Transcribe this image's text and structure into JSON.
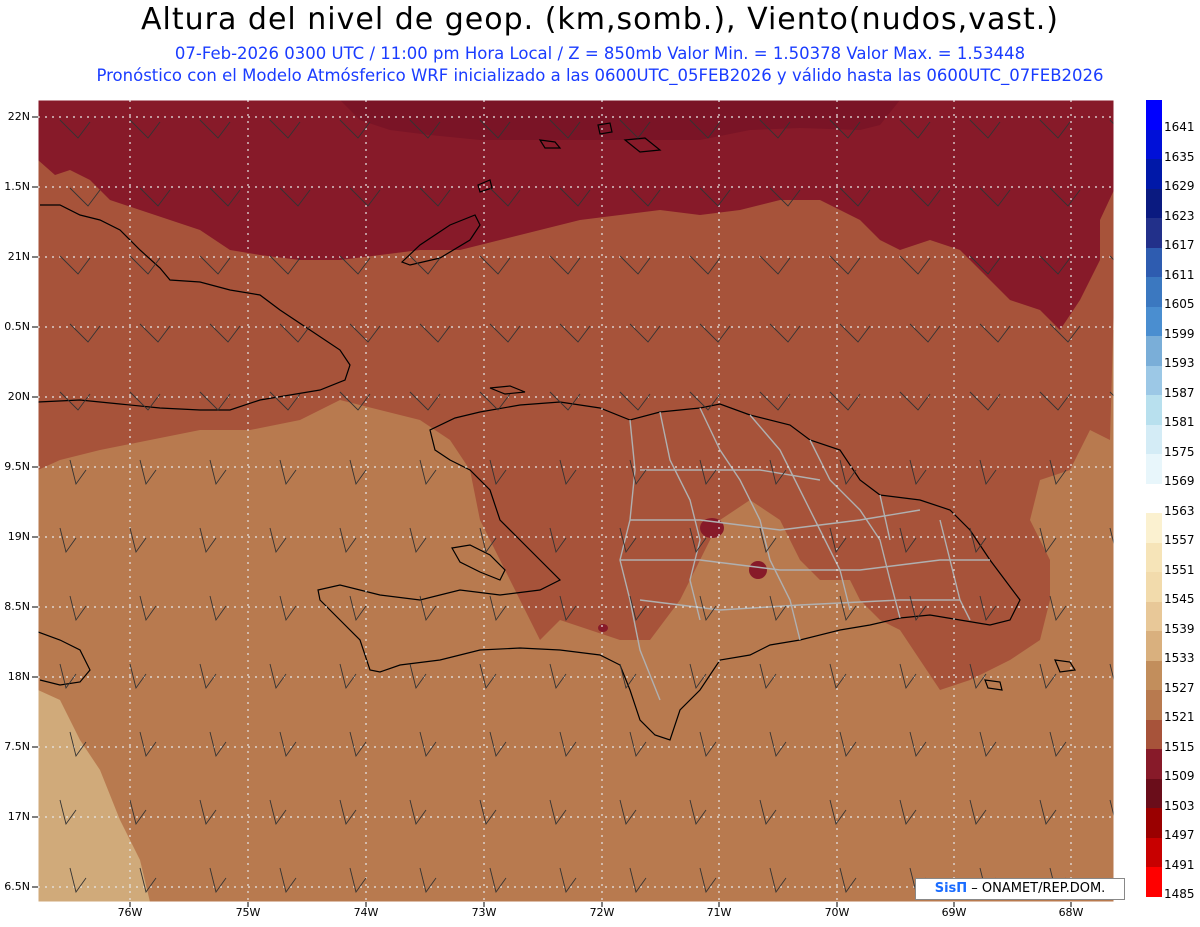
{
  "header": {
    "title": "Altura del nivel de geop. (km,somb.), Viento(nudos,vast.)",
    "line1": "07-Feb-2026  0300 UTC / 11:00 pm Hora Local / Z = 850mb    Valor Min. = 1.50378  Valor Max. = 1.53448",
    "line2": "Pronóstico con el Modelo Atmósferico WRF inicializado a las 0600UTC_05FEB2026 y válido hasta las  0600UTC_07FEB2026"
  },
  "map": {
    "lat_labels": [
      "22N",
      "1.5N",
      "21N",
      "0.5N",
      "20N",
      "9.5N",
      "19N",
      "8.5N",
      "18N",
      "7.5N",
      "17N",
      "6.5N"
    ],
    "lon_labels": [
      "76W",
      "75W",
      "74W",
      "73W",
      "72W",
      "71W",
      "70W",
      "69W",
      "68W"
    ],
    "fill_colors": {
      "highest": "#7a1426",
      "high": "#871a29",
      "mid": "#a7533a",
      "low": "#b87a4f",
      "lowest": "#d0aa7a"
    }
  },
  "colorbar": {
    "labels": [
      "1641",
      "1635",
      "1629",
      "1623",
      "1617",
      "1611",
      "1605",
      "1599",
      "1593",
      "1587",
      "1581",
      "1575",
      "1569",
      "1563",
      "1557",
      "1551",
      "1545",
      "1539",
      "1533",
      "1527",
      "1521",
      "1515",
      "1509",
      "1503",
      "1497",
      "1491",
      "1485"
    ],
    "colors": [
      "#0000ff",
      "#0010d8",
      "#0018a8",
      "#0a1a80",
      "#22308a",
      "#2e5cb0",
      "#3b78c0",
      "#4a8ed0",
      "#7aaed8",
      "#9cc8e6",
      "#b8e0ee",
      "#d4ecf6",
      "#e8f6fb",
      "#ffffff",
      "#fbf1d0",
      "#f6e4b8",
      "#f2dbac",
      "#e8c898",
      "#d9b07e",
      "#c28e5c",
      "#b87a4f",
      "#a7533a",
      "#871a29",
      "#6a0d1a",
      "#9a0000",
      "#c80000",
      "#ff0000"
    ]
  },
  "credit": {
    "logo": "SisΠ",
    "text": " – ONAMET/REP.DOM."
  }
}
